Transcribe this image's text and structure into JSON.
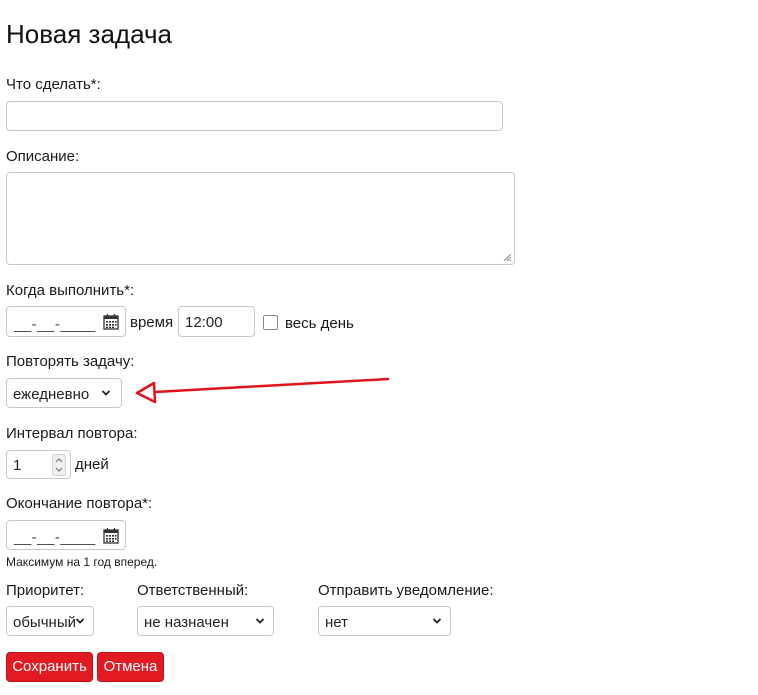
{
  "page_title": "Новая задача",
  "what": {
    "label": "Что сделать*:",
    "value": ""
  },
  "description": {
    "label": "Описание:",
    "value": ""
  },
  "when": {
    "label": "Когда выполнить*:",
    "date_placeholder": "__-__-____",
    "time_label": "время",
    "time_value": "12:00",
    "all_day_label": "весь день",
    "all_day_checked": false
  },
  "repeat": {
    "label": "Повторять задачу:",
    "selected": "ежедневно"
  },
  "interval": {
    "label": "Интервал повтора:",
    "value": "1",
    "unit": "дней"
  },
  "repeat_end": {
    "label": "Окончание повтора*:",
    "date_placeholder": "__-__-____",
    "hint": "Максимум на 1 год вперед."
  },
  "priority": {
    "label": "Приоритет:",
    "selected": "обычный"
  },
  "responsible": {
    "label": "Ответственный:",
    "selected": "не назначен"
  },
  "notify": {
    "label": "Отправить уведомление:",
    "selected": "нет"
  },
  "buttons": {
    "save": "Сохранить",
    "cancel": "Отмена"
  },
  "colors": {
    "button_red": "#e21b23",
    "annotation_arrow": "#e0141c"
  },
  "icons": [
    "calendar-icon",
    "chevron-down-icon",
    "spinner-arrows-icon"
  ]
}
